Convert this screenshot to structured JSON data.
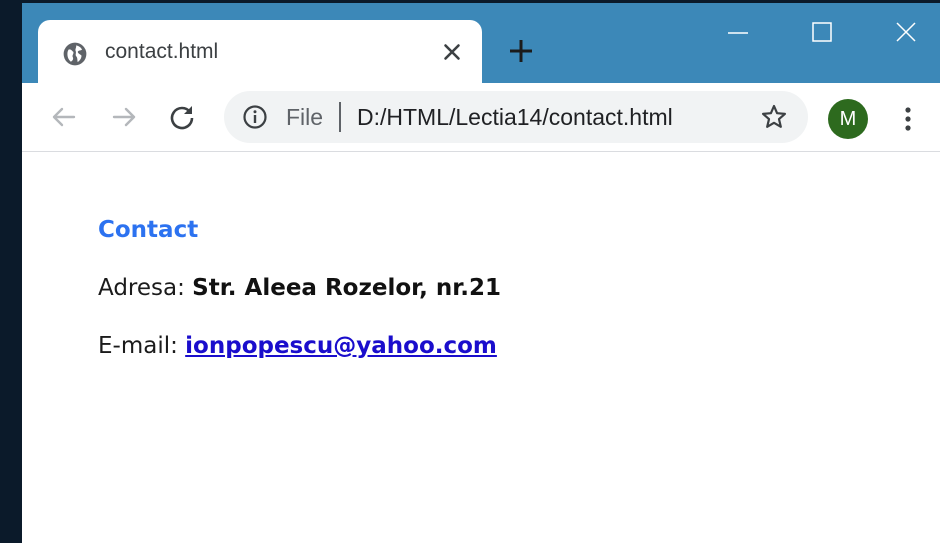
{
  "browser": {
    "tab": {
      "title": "contact.html",
      "icon": "globe-icon"
    },
    "address_bar": {
      "scheme_label": "File",
      "url": "D:/HTML/Lectia14/contact.html"
    },
    "profile": {
      "initial": "M",
      "color": "#2d6a1e"
    },
    "frame_color": "#3c88b8"
  },
  "page": {
    "heading": "Contact",
    "address": {
      "label": "Adresa: ",
      "value": "Str. Aleea Rozelor, nr.21"
    },
    "email": {
      "label": "E-mail: ",
      "value": "ionpopescu@yahoo.com"
    },
    "heading_color": "#2c72f0",
    "link_color": "#1a0dcc"
  }
}
